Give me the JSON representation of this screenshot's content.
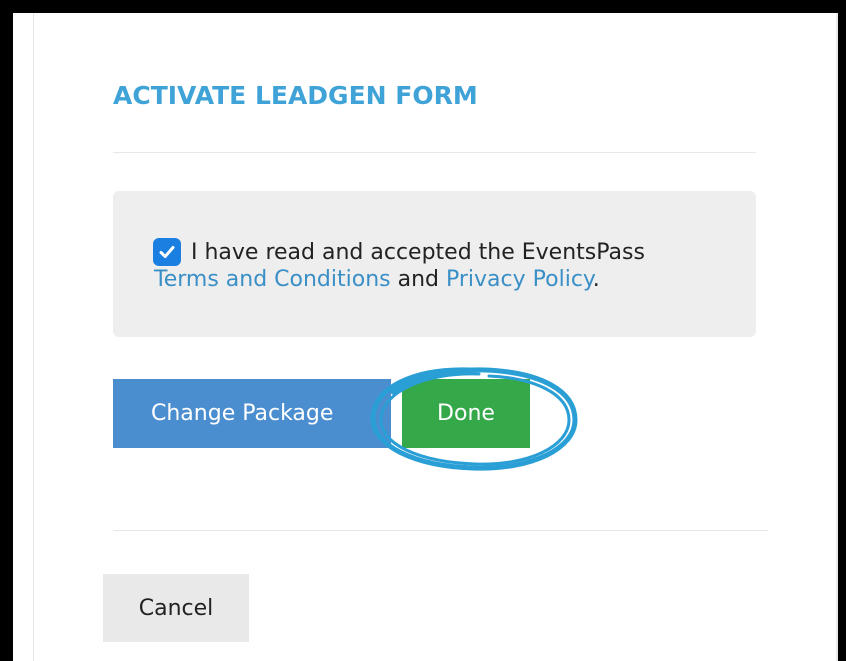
{
  "modal": {
    "title": "ACTIVATE LEADGEN FORM",
    "terms": {
      "checked": true,
      "text_prefix": "I have read and accepted the EventsPass",
      "terms_link": "Terms and Conditions",
      "connector": "and",
      "privacy_link": "Privacy Policy",
      "end_punct": "."
    },
    "buttons": {
      "change_package": "Change Package",
      "done": "Done",
      "cancel": "Cancel"
    }
  },
  "colors": {
    "title": "#3fa3d8",
    "link": "#3a8fc7",
    "change_package_bg": "#4b8ecf",
    "done_bg": "#35a84a",
    "highlight": "#2a9fd6",
    "checkbox": "#1a7fe0"
  },
  "icons": {
    "checkbox": "checkmark-icon",
    "annotation": "highlight-circle"
  }
}
